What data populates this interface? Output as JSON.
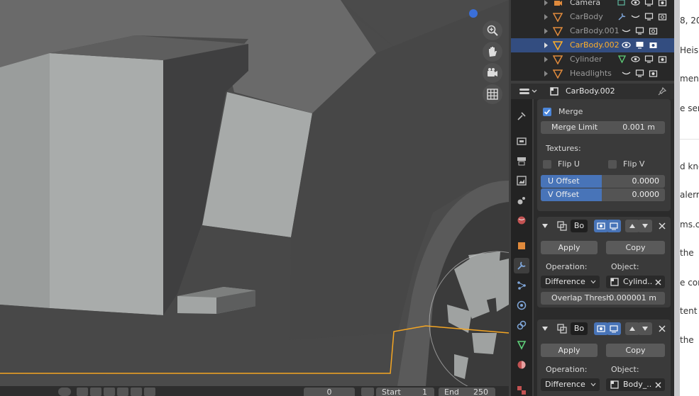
{
  "outliner": {
    "rows": [
      {
        "name": "Camera",
        "selected": false,
        "type": "camera"
      },
      {
        "name": "CarBody",
        "selected": false,
        "type": "mesh"
      },
      {
        "name": "CarBody.001",
        "selected": false,
        "type": "mesh"
      },
      {
        "name": "CarBody.002",
        "selected": true,
        "type": "mesh"
      },
      {
        "name": "Cylinder",
        "selected": false,
        "type": "mesh"
      },
      {
        "name": "Headlights",
        "selected": false,
        "type": "mesh"
      }
    ]
  },
  "properties": {
    "object_name": "CarBody.002",
    "weld_section": {
      "merge_label": "Merge",
      "merge_checked": true,
      "merge_limit_label": "Merge Limit",
      "merge_limit_value": "0.001 m",
      "textures_label": "Textures:",
      "flip_u_label": "Flip U",
      "flip_v_label": "Flip V",
      "u_offset_label": "U Offset",
      "u_offset_value": "0.0000",
      "v_offset_label": "V Offset",
      "v_offset_value": "0.0000"
    },
    "boolean_1": {
      "name": "Bo",
      "apply_label": "Apply",
      "copy_label": "Copy",
      "operation_label": "Operation:",
      "operation_value": "Difference",
      "object_label": "Object:",
      "object_value": "Cylind..",
      "overlap_label": "Overlap Thresh",
      "overlap_value": "0.000001 m"
    },
    "boolean_2": {
      "name": "Bo",
      "apply_label": "Apply",
      "copy_label": "Copy",
      "operation_label": "Operation:",
      "operation_value": "Difference",
      "object_label": "Object:",
      "object_value": "Body_.."
    }
  },
  "timeline": {
    "current_frame": "0",
    "start_label": "Start",
    "start_value": "1",
    "end_label": "End",
    "end_value": "250"
  },
  "document": {
    "lines": [
      "8, 20",
      "Heis",
      "ments",
      "e ser",
      "d kno",
      "alerr",
      "ms.c",
      "the",
      "e cor",
      "tent",
      "the"
    ]
  },
  "colors": {
    "selection": "#334d80",
    "selected_text": "#ffaf29",
    "accent": "#4874b8",
    "wire_orange": "#f5a623"
  }
}
